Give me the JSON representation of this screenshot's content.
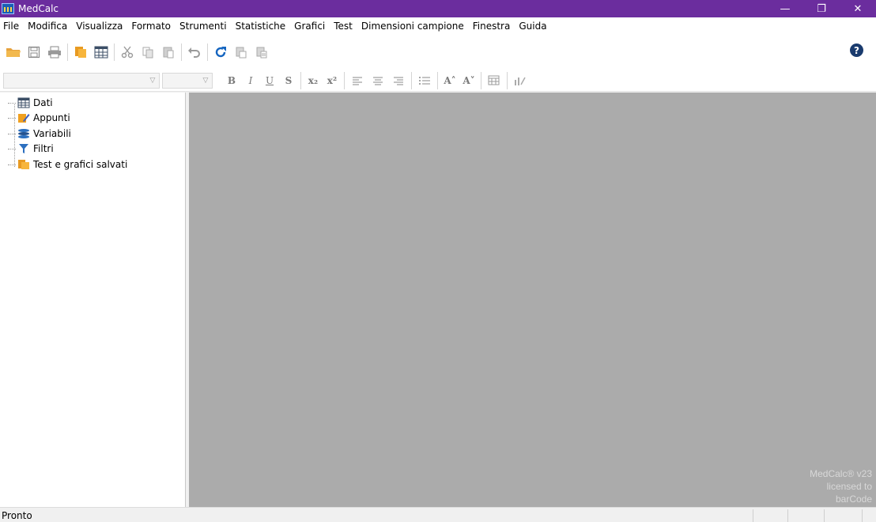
{
  "window": {
    "title": "MedCalc"
  },
  "window_controls": {
    "minimize": "—",
    "maximize": "❐",
    "close": "✕"
  },
  "menu": [
    "File",
    "Modifica",
    "Visualizza",
    "Formato",
    "Strumenti",
    "Statistiche",
    "Grafici",
    "Test",
    "Dimensioni campione",
    "Finestra",
    "Guida"
  ],
  "toolbar": {
    "help": "?",
    "icons": [
      "open-folder-icon",
      "save-icon",
      "print-icon",
      "open-notes-icon",
      "spreadsheet-icon",
      "cut-icon",
      "copy-icon",
      "paste-icon",
      "undo-icon",
      "refresh-icon",
      "copy-to-clipboard-icon",
      "paste-special-icon"
    ]
  },
  "format_toolbar": {
    "bold": "B",
    "italic": "I",
    "underline": "U",
    "strike": "S",
    "subscript": "x₂",
    "superscript": "x²",
    "font_size_up": "A˄",
    "font_size_down": "A˅"
  },
  "tree": {
    "items": [
      {
        "label": "Dati",
        "icon": "table-icon"
      },
      {
        "label": "Appunti",
        "icon": "notes-icon"
      },
      {
        "label": "Variabili",
        "icon": "variables-icon"
      },
      {
        "label": "Filtri",
        "icon": "filter-icon"
      },
      {
        "label": "Test e grafici salvati",
        "icon": "saved-tests-icon"
      }
    ]
  },
  "license": {
    "line1": "MedCalc® v23",
    "line2": "licensed to",
    "line3": "barCode"
  },
  "status": {
    "text": "Pronto"
  },
  "colors": {
    "titlebar": "#6b2d9e",
    "workspace": "#ababab",
    "accent_orange": "#f0a020"
  }
}
